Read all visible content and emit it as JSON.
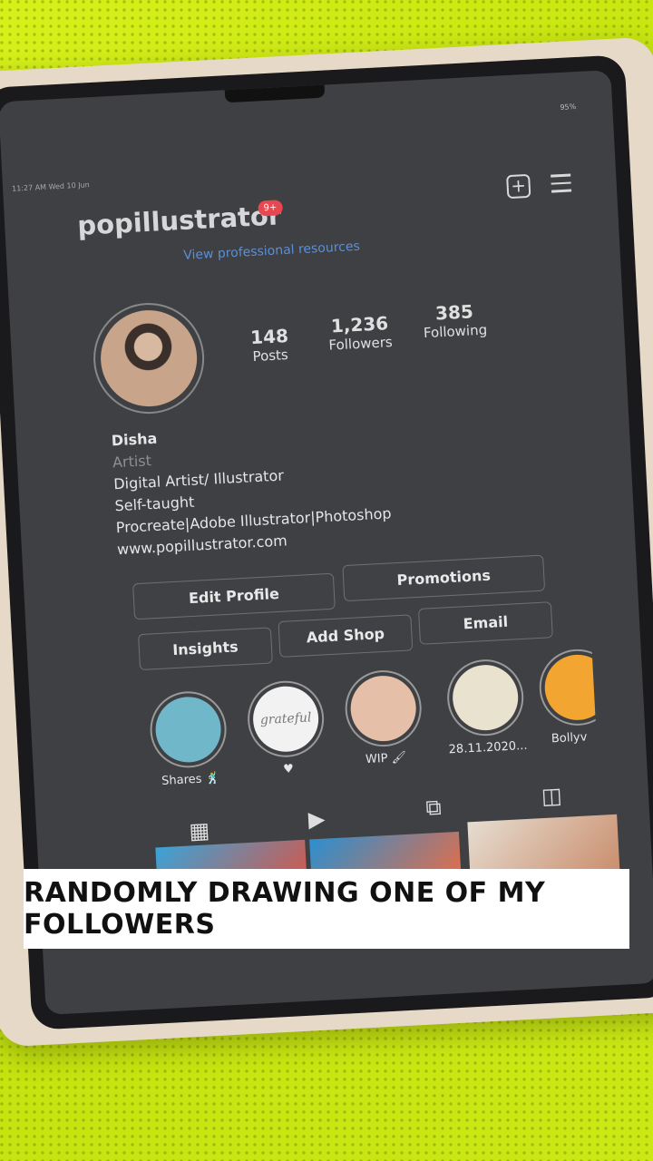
{
  "status": {
    "time": "11:27 AM  Wed 10 Jun",
    "battery": "95%"
  },
  "profile": {
    "username": "popillustrator",
    "notif_badge": "9+",
    "pro_link": "View professional resources",
    "stats": [
      {
        "value": "148",
        "label": "Posts"
      },
      {
        "value": "1,236",
        "label": "Followers"
      },
      {
        "value": "385",
        "label": "Following"
      }
    ],
    "name": "Disha",
    "category": "Artist",
    "bio_lines": [
      "Digital Artist/ Illustrator",
      "Self-taught",
      "Procreate|Adobe Illustrator|Photoshop"
    ],
    "website": "www.popillustrator.com"
  },
  "buttons": {
    "edit_profile": "Edit Profile",
    "promotions": "Promotions",
    "insights": "Insights",
    "add_shop": "Add Shop",
    "email": "Email"
  },
  "highlights": [
    {
      "label": "Shares 🕺",
      "color": "#6fb7c9"
    },
    {
      "label": "♥",
      "color": "#f2f2f2",
      "inner_text": "grateful"
    },
    {
      "label": "WIP 🖌",
      "color": "#e6bfa8"
    },
    {
      "label": "28.11.2020...",
      "color": "#e9e2cf"
    },
    {
      "label": "Bollyv",
      "color": "#f3a531"
    }
  ],
  "tabs": [
    "grid-icon",
    "reels-icon",
    "igtv-icon",
    "tagged-icon"
  ],
  "caption": "RANDOMLY DRAWING ONE OF MY FOLLOWERS",
  "colors": {
    "accent": "#5b8fd6",
    "badge": "#e8474f",
    "surface": "#d6f01a"
  }
}
